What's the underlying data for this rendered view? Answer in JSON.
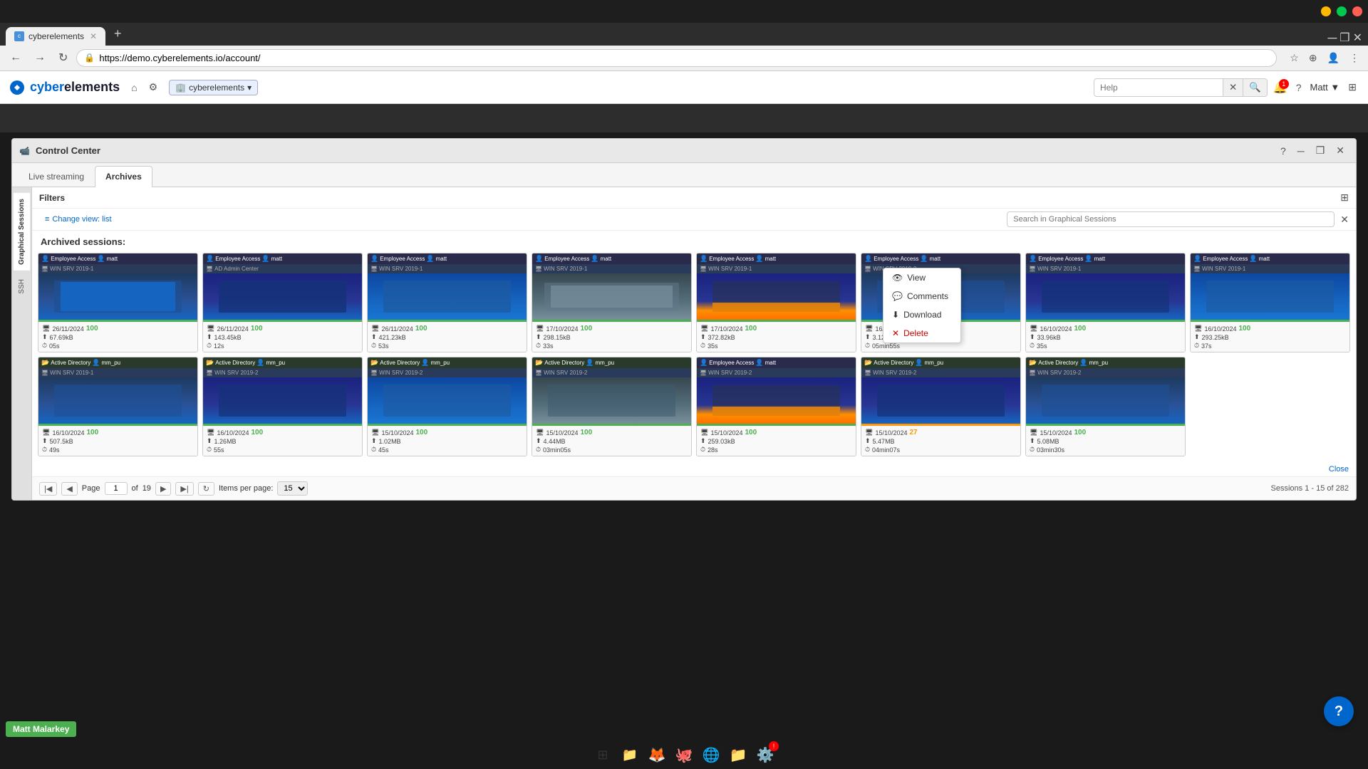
{
  "browser": {
    "tab_label": "cyberelements",
    "url": "https://demo.cyberelements.io/account/",
    "new_tab_label": "+"
  },
  "app": {
    "logo_text": "cyberelements",
    "logo_prefix": "cyber",
    "logo_suffix": "elements",
    "org_label": "cyberelements",
    "header_search_placeholder": "Help",
    "notification_count": "1",
    "user_label": "Matt ▼"
  },
  "panel": {
    "title": "Control Center",
    "tab_live": "Live streaming",
    "tab_archives": "Archives",
    "sidebar_graphical": "Graphical Sessions",
    "sidebar_ssh": "SSH",
    "filters_label": "Filters",
    "view_change_label": "Change view: list",
    "search_placeholder": "Search in Graphical Sessions",
    "sessions_title": "Archived sessions:",
    "context_menu": {
      "view": "View",
      "comments": "Comments",
      "download": "Download",
      "delete": "Delete"
    },
    "pagination": {
      "page_label": "Page",
      "page_value": "1",
      "of_label": "of",
      "total_pages": "19",
      "items_per_page_label": "Items per page:",
      "items_per_page_value": "15",
      "session_range": "Sessions 1 - 15 of 282"
    }
  },
  "sessions": [
    {
      "id": "s1",
      "header": "Employee Access  matt",
      "sub": "WIN SRV 2019-1",
      "date": "26/11/2024",
      "size": "67.69kB",
      "duration": "05s",
      "score": "100",
      "score_color": "green",
      "screen_type": "blue",
      "row": 1
    },
    {
      "id": "s2",
      "header": "Employee Access  matt",
      "sub": "AD Admin Center",
      "date": "26/11/2024",
      "size": "143.45kB",
      "duration": "12s",
      "score": "100",
      "score_color": "green",
      "screen_type": "dark",
      "row": 1
    },
    {
      "id": "s3",
      "header": "Employee Access  matt",
      "sub": "WIN SRV 2019-1",
      "date": "26/11/2024",
      "size": "421.23kB",
      "duration": "53s",
      "score": "100",
      "score_color": "green",
      "screen_type": "blue",
      "row": 1
    },
    {
      "id": "s4",
      "header": "Employee Access  matt",
      "sub": "WIN SRV 2019-1",
      "date": "17/10/2024",
      "size": "298.15kB",
      "duration": "33s",
      "score": "100",
      "score_color": "green",
      "screen_type": "gray",
      "row": 1
    },
    {
      "id": "s5",
      "header": "Employee Access  matt",
      "sub": "WIN SRV 2019-1",
      "date": "17/10/2024",
      "size": "372.82kB",
      "duration": "35s",
      "score": "100",
      "score_color": "green",
      "screen_type": "orange",
      "row": 1
    },
    {
      "id": "s6",
      "header": "Employee Access  matt",
      "sub": "WIN SRV 2019-2",
      "date": "16/10/2024",
      "size": "3.12MB",
      "duration": "05min55s",
      "score": "100",
      "score_color": "green",
      "screen_type": "blue",
      "context_menu": true,
      "row": 1
    },
    {
      "id": "s7",
      "header": "Employee Access  matt",
      "sub": "WIN SRV 2019-1",
      "date": "16/10/2024",
      "size": "33.96kB",
      "duration": "35s",
      "score": "100",
      "score_color": "green",
      "screen_type": "blue",
      "row": 1
    },
    {
      "id": "s8",
      "header": "Employee Access  matt",
      "sub": "WIN SRV 2019-1",
      "date": "16/10/2024",
      "size": "293.25kB",
      "duration": "37s",
      "score": "100",
      "score_color": "green",
      "screen_type": "dark",
      "row": 1
    },
    {
      "id": "s9",
      "header": "Active Directory  mm_pu",
      "sub": "WIN SRV 2019-1",
      "date": "16/10/2024",
      "size": "507.5kB",
      "duration": "49s",
      "score": "100",
      "score_color": "green",
      "screen_type": "blue",
      "row": 2
    },
    {
      "id": "s10",
      "header": "Active Directory  mm_pu",
      "sub": "WIN SRV 2019-2",
      "date": "16/10/2024",
      "size": "1.26MB",
      "duration": "55s",
      "score": "100",
      "score_color": "green",
      "screen_type": "blue",
      "row": 2
    },
    {
      "id": "s11",
      "header": "Active Directory  mm_pu",
      "sub": "WIN SRV 2019-2",
      "date": "15/10/2024",
      "size": "1.02MB",
      "duration": "45s",
      "score": "100",
      "score_color": "green",
      "screen_type": "blue",
      "row": 2
    },
    {
      "id": "s12",
      "header": "Active Directory  mm_pu",
      "sub": "WIN SRV 2019-2",
      "date": "15/10/2024",
      "size": "4.44MB",
      "duration": "03min05s",
      "score": "100",
      "score_color": "green",
      "screen_type": "blue",
      "row": 2
    },
    {
      "id": "s13",
      "header": "Employee Access  matt",
      "sub": "WIN SRV 2019-2",
      "date": "15/10/2024",
      "size": "259.03kB",
      "duration": "28s",
      "score": "100",
      "score_color": "green",
      "screen_type": "orange",
      "row": 2
    },
    {
      "id": "s14",
      "header": "Active Directory  mm_pu",
      "sub": "WIN SRV 2019-2",
      "date": "15/10/2024",
      "size": "5.47MB",
      "duration": "04min07s",
      "score": "27",
      "score_color": "orange",
      "screen_type": "blue",
      "row": 2
    },
    {
      "id": "s15",
      "header": "Active Directory  mm_pu",
      "sub": "WIN SRV 2019-2",
      "date": "15/10/2024",
      "size": "5.08MB",
      "duration": "03min30s",
      "score": "100",
      "score_color": "green",
      "screen_type": "blue",
      "row": 2
    }
  ],
  "taskbar": {
    "icons": [
      "⊞",
      "📁",
      "🦊",
      "🐙",
      "🌐",
      "📁",
      "⚙️"
    ]
  },
  "bottom_tooltip": "Matt Malarkey",
  "help_btn": "?"
}
